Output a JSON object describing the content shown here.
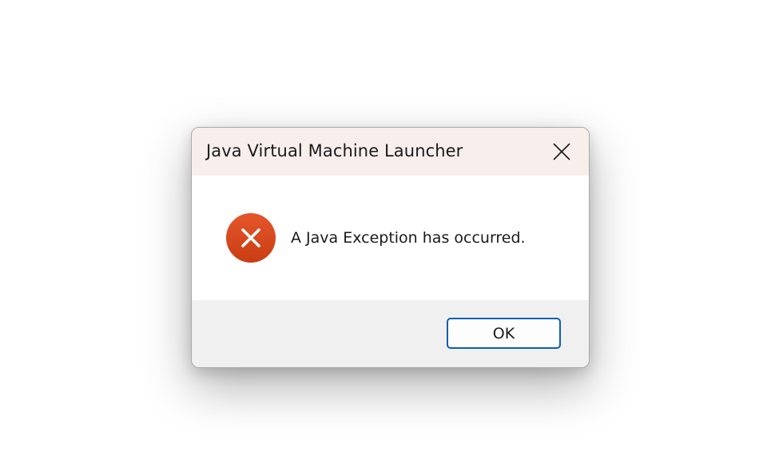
{
  "dialog": {
    "title": "Java Virtual Machine Launcher",
    "message": "A Java Exception has occurred.",
    "icon": "error-icon",
    "close_icon": "close-icon",
    "ok_label": "OK"
  },
  "colors": {
    "titlebar_bg": "#f8efed",
    "footer_bg": "#f0f0f0",
    "error_red": "#d9421b",
    "button_border": "#0a5fb4"
  }
}
